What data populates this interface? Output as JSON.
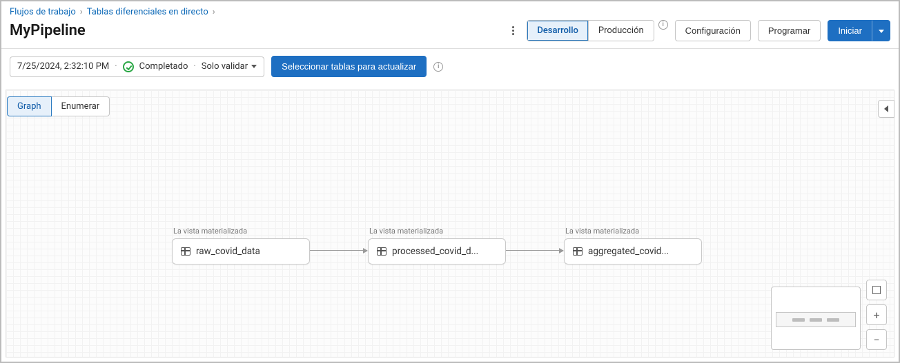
{
  "breadcrumb": {
    "item1": "Flujos de trabajo",
    "item2": "Tablas diferenciales en directo"
  },
  "page_title": "MyPipeline",
  "mode_toggle": {
    "dev": "Desarrollo",
    "prod": "Producción"
  },
  "buttons": {
    "config": "Configuración",
    "schedule": "Programar",
    "start": "Iniciar"
  },
  "run_summary": {
    "timestamp": "7/25/2024, 2:32:10 PM",
    "status": "Completado",
    "validate_label": "Solo validar"
  },
  "select_tables_btn": "Seleccionar tablas para actualizar",
  "view_tabs": {
    "graph": "Graph",
    "list": "Enumerar"
  },
  "node_label": "La vista materializada",
  "nodes": {
    "n1": "raw_covid_data",
    "n2": "processed_covid_d...",
    "n3": "aggregated_covid..."
  }
}
